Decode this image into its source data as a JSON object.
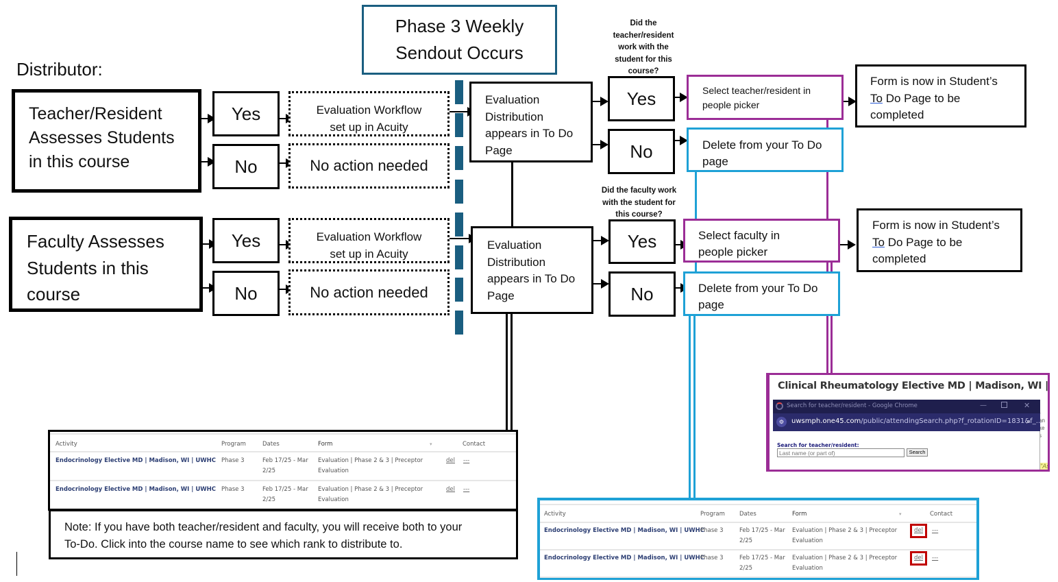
{
  "distributor_label": "Distributor:",
  "header": {
    "line1": "Phase 3 Weekly",
    "line2": "Sendout Occurs"
  },
  "colors": {
    "teal": "#1a5e80",
    "purple": "#9b2d96",
    "cyan": "#1ea1d6",
    "red_highlight": "#c00000",
    "link_blue": "#2c3e73",
    "chrome_dark": "#1f1f4d",
    "chrome_url_bar": "#2b2b6b"
  },
  "teacher_flow": {
    "source": "Teacher/Resident Assesses Students in this course",
    "source_lines": [
      "Teacher/Resident",
      "Assesses Students",
      "in this course"
    ],
    "yes": "Yes",
    "no": "No",
    "workflow": "Evaluation Workflow set up in Acuity",
    "workflow_lines": [
      "Evaluation Workflow",
      "set up in Acuity"
    ],
    "no_action": "No action needed",
    "distribution_lines": [
      "Evaluation",
      "Distribution",
      "appears in To Do",
      "Page"
    ],
    "question_lines": [
      "Did the",
      "teacher/resident",
      "work with the",
      "student for this",
      "course?"
    ],
    "yes2": "Yes",
    "no2": "No",
    "select": "Select teacher/resident in people picker",
    "select_lines": [
      "Select teacher/resident in",
      "people picker"
    ],
    "delete_lines": [
      "Delete from your To Do",
      "page"
    ],
    "result_lines": [
      "Form is now in Student’s",
      "To",
      " Do Page to be",
      "completed"
    ]
  },
  "faculty_flow": {
    "source_lines": [
      "Faculty Assesses",
      "Students in this",
      "course"
    ],
    "yes": "Yes",
    "no": "No",
    "workflow_lines": [
      "Evaluation Workflow",
      "set up in Acuity"
    ],
    "no_action": "No action needed",
    "distribution_lines": [
      "Evaluation",
      "Distribution",
      "appears in To Do",
      "Page"
    ],
    "question_lines": [
      "Did the faculty work",
      "with the student for",
      "this course?"
    ],
    "yes2": "Yes",
    "no2": "No",
    "select_lines": [
      "Select faculty in",
      "people picker"
    ],
    "delete_lines": [
      "Delete from your To Do",
      "page"
    ],
    "result_lines": [
      "Form is now in Student’s",
      "To",
      " Do Page to be",
      "completed"
    ]
  },
  "todo_table": {
    "columns": [
      "Activity",
      "Program",
      "Dates",
      "Form",
      "▾",
      "Contact"
    ],
    "rows": [
      {
        "activity": "Endocrinology Elective MD | Madison, WI | UWHC",
        "program": "Phase 3",
        "dates_1": "Feb 17/25 - Mar",
        "dates_2": "2/25",
        "form_1": "Evaluation | Phase 2 & 3 | Preceptor",
        "form_2": "Evaluation",
        "del": "del",
        "contact": "---"
      },
      {
        "activity": "Endocrinology Elective MD | Madison, WI | UWHC",
        "program": "Phase 3",
        "dates_1": "Feb 17/25 - Mar",
        "dates_2": "2/25",
        "form_1": "Evaluation | Phase 2 & 3 | Preceptor",
        "form_2": "Evaluation",
        "del": "del",
        "contact": "---"
      }
    ]
  },
  "note": {
    "line1": "Note: If you have both teacher/resident and faculty, you will receive both to your",
    "line2": "To-Do. Click into the course name to see which rank to distribute to."
  },
  "picker_screenshot": {
    "course_title": "Clinical Rheumatology Elective MD | Madison, WI | UWHC",
    "window_title": "Search for teacher/resident - Google Chrome",
    "url_domain": "uwsmph.one45.com",
    "url_path": "/public/attendingSearch.php?f_rotationID=1831&f_...",
    "search_label": "Search for teacher/resident:",
    "search_placeholder": "Last name (or part of)",
    "search_button": "Search",
    "side_text_1": ") an",
    "side_text_2": "ke s",
    "side_text_3": "\"As"
  }
}
